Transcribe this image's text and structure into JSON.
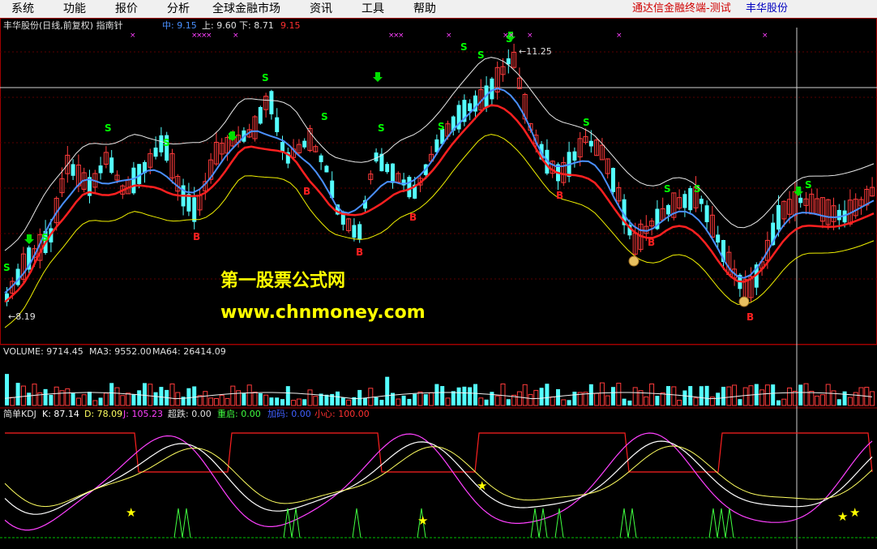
{
  "menu": {
    "items": [
      "系统",
      "功能",
      "报价",
      "分析",
      "全球金融市场",
      "资讯",
      "工具",
      "帮助"
    ],
    "app_title": "通达信金融终端-测试",
    "stock_name": "丰华股份"
  },
  "main_panel": {
    "title": "丰华股份(日线,前复权) 指南针",
    "mid_label": "中: 9.15",
    "upper_label": "上: 9.60",
    "lower_label": "下: 8.71",
    "extra_value": "9.15",
    "high_mark": "11.25",
    "low_mark": "8.19"
  },
  "watermark": {
    "line1": "第一股票公式网",
    "line2": "www.chnmoney.com"
  },
  "volume_panel": {
    "volume_label": "VOLUME: 9714.45",
    "ma3_label": "MA3: 9552.00",
    "ma64_label": "MA64: 26414.09"
  },
  "kdj_panel": {
    "title": "简单KDJ",
    "k_label": "K: 87.14",
    "d_label": "D: 78.09",
    "j_label": "J: 105.23",
    "chaodie_label": "超跌: 0.00",
    "chongqi_label": "重启: 0.00",
    "jiama_label": "加码: 0.00",
    "xiaoxin_label": "小心: 100.00"
  },
  "signals": {
    "sell": "S",
    "buy": "B"
  },
  "colors": {
    "up_candle": "#ff3b3b",
    "down_candle": "#54ffff",
    "mid_line": "#4a90ff",
    "ma_red": "#ff2020",
    "band_upper": "#e8e8e8",
    "band_lower": "#f0f000",
    "kdj_k": "#ffffff",
    "kdj_d": "#ffff60",
    "kdj_j": "#ff40ff",
    "xiaoxin": "#ff2020",
    "chaodie": "#40ff40",
    "sell_signal": "#00ff00",
    "buy_signal": "#ff2020",
    "watermark": "#ffff00"
  }
}
